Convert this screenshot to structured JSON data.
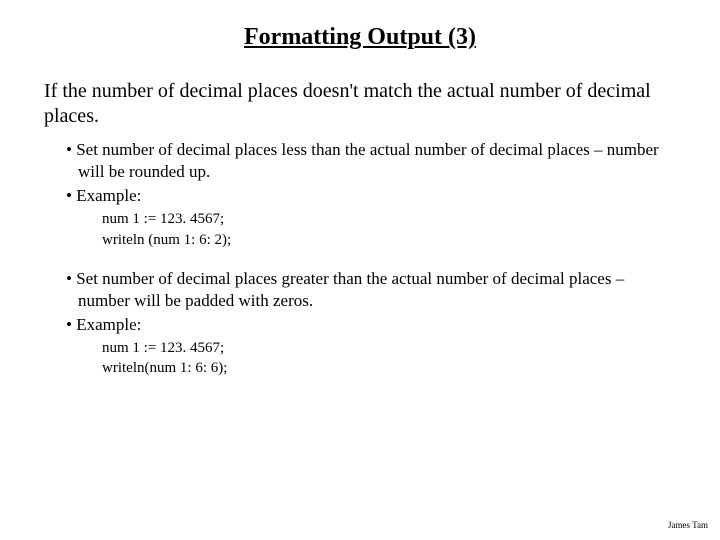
{
  "title": "Formatting Output (3)",
  "intro": "If the number of decimal places doesn't match the actual number of decimal places.",
  "bullets1": [
    "Set number of decimal places less than the actual number of decimal places – number will be rounded up.",
    "Example:"
  ],
  "code1": {
    "line1": "num 1 := 123. 4567;",
    "line2": "writeln (num 1: 6: 2);"
  },
  "bullets2": [
    "Set number of decimal places greater than the actual number of decimal places – number will be padded with zeros.",
    "Example:"
  ],
  "code2": {
    "line1": "num 1 := 123. 4567;",
    "line2": "writeln(num 1: 6: 6);"
  },
  "footer": "James Tam"
}
